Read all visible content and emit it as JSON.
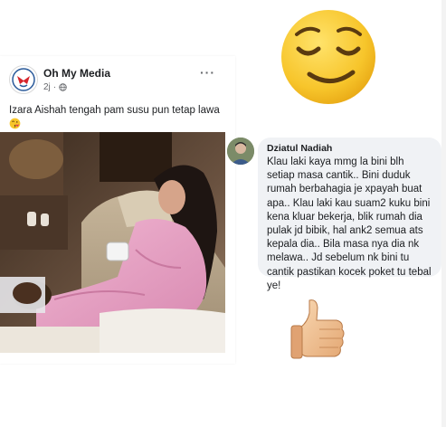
{
  "post": {
    "page_name": "Oh My Media",
    "time": "2j",
    "privacy_icon": "globe-icon",
    "more_label": "···",
    "caption": "Izara Aishah tengah pam susu pun tetap lawa",
    "caption_emoji": "kissing-face-emoji"
  },
  "comment": {
    "author": "Dziatul Nadiah",
    "text": "Klau laki kaya mmg la bini blh setiap masa cantik.. Bini duduk rumah berbahagia je xpayah buat apa.. Klau laki kau suam2 kuku bini kena kluar bekerja, blik rumah dia pulak jd bibik, hal ank2 semua ats kepala dia.. Bila masa nya dia nk melawa.. Jd sebelum nk bini tu cantik pastikan kocek poket tu tebal ye!"
  },
  "stickers": {
    "top": "relieved-face-emoji",
    "bottom": "thumbs-up-emoji"
  },
  "colors": {
    "emoji_yellow": "#f7c52b",
    "pajama_pink": "#e6a3c3",
    "bubble_bg": "#f0f2f5"
  }
}
